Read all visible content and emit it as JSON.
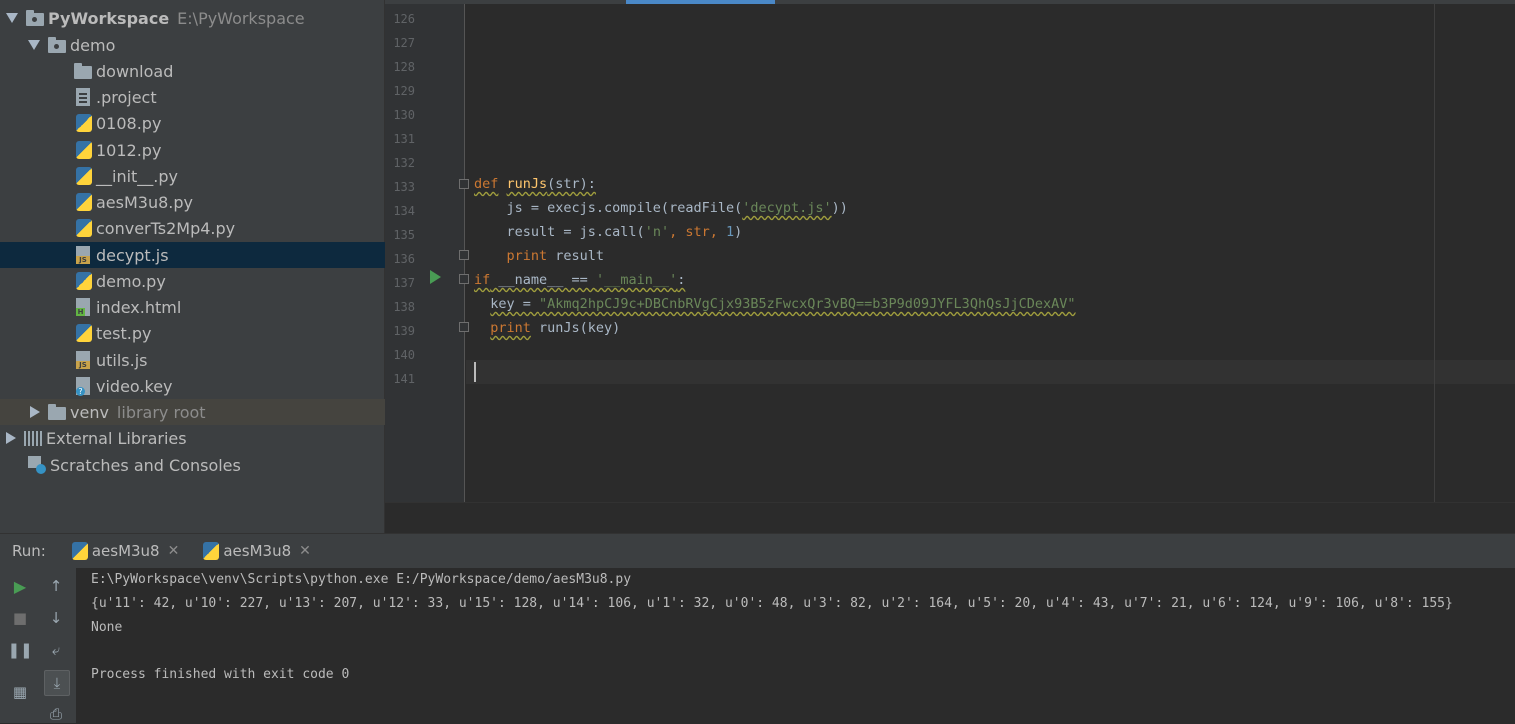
{
  "project_tree": {
    "root": {
      "name": "PyWorkspace",
      "path": "E:\\PyWorkspace"
    },
    "demo_folder": "demo",
    "items": [
      {
        "label": "download"
      },
      {
        "label": ".project"
      },
      {
        "label": "0108.py"
      },
      {
        "label": "1012.py"
      },
      {
        "label": "__init__.py"
      },
      {
        "label": "aesM3u8.py"
      },
      {
        "label": "converTs2Mp4.py"
      },
      {
        "label": "decypt.js"
      },
      {
        "label": "demo.py"
      },
      {
        "label": "index.html"
      },
      {
        "label": "test.py"
      },
      {
        "label": "utils.js"
      },
      {
        "label": "video.key"
      }
    ],
    "venv": {
      "label": "venv",
      "hint": "library root"
    },
    "external_libraries": "External Libraries",
    "scratches": "Scratches and Consoles"
  },
  "editor": {
    "line_numbers": [
      "126",
      "127",
      "128",
      "129",
      "130",
      "131",
      "132",
      "133",
      "134",
      "135",
      "136",
      "137",
      "138",
      "139",
      "140",
      "141"
    ],
    "code": {
      "l133_kw": "def",
      "l133_fn": "runJs",
      "l133_rest": "(str):",
      "l134_a": "    js = execjs.compile(readFile(",
      "l134_str": "'decypt.js'",
      "l134_b": "))",
      "l135_a": "    result = js.call(",
      "l135_str": "'n'",
      "l135_b": ", str, ",
      "l135_num": "1",
      "l135_c": ")",
      "l136_kw": "print",
      "l136_rest": " result",
      "l137_kw": "if",
      "l137_a": " __name__ == ",
      "l137_str": "'__main__'",
      "l137_b": ":",
      "l138_a": "key = ",
      "l138_str": "\"Akmq2hpCJ9c+DBCnbRVgCjx93B5zFwcxQr3vBQ==b3P9d09JYFL3QhQsJjCDexAV\"",
      "l139_kw": "print",
      "l139_rest": " runJs(key)"
    }
  },
  "run_panel": {
    "label": "Run:",
    "tabs": [
      {
        "label": "aesM3u8"
      },
      {
        "label": "aesM3u8"
      }
    ],
    "output": [
      "E:\\PyWorkspace\\venv\\Scripts\\python.exe E:/PyWorkspace/demo/aesM3u8.py",
      "{u'11': 42, u'10': 227, u'13': 207, u'12': 33, u'15': 128, u'14': 106, u'1': 32, u'0': 48, u'3': 82, u'2': 164, u'5': 20, u'4': 43, u'7': 21, u'6': 124, u'9': 106, u'8': 155}",
      "None",
      "",
      "Process finished with exit code 0"
    ]
  },
  "colors": {
    "keyword": "#cc7832",
    "function": "#ffc66d",
    "string": "#6a8759",
    "number": "#6897bb",
    "selection": "#0d293e"
  }
}
